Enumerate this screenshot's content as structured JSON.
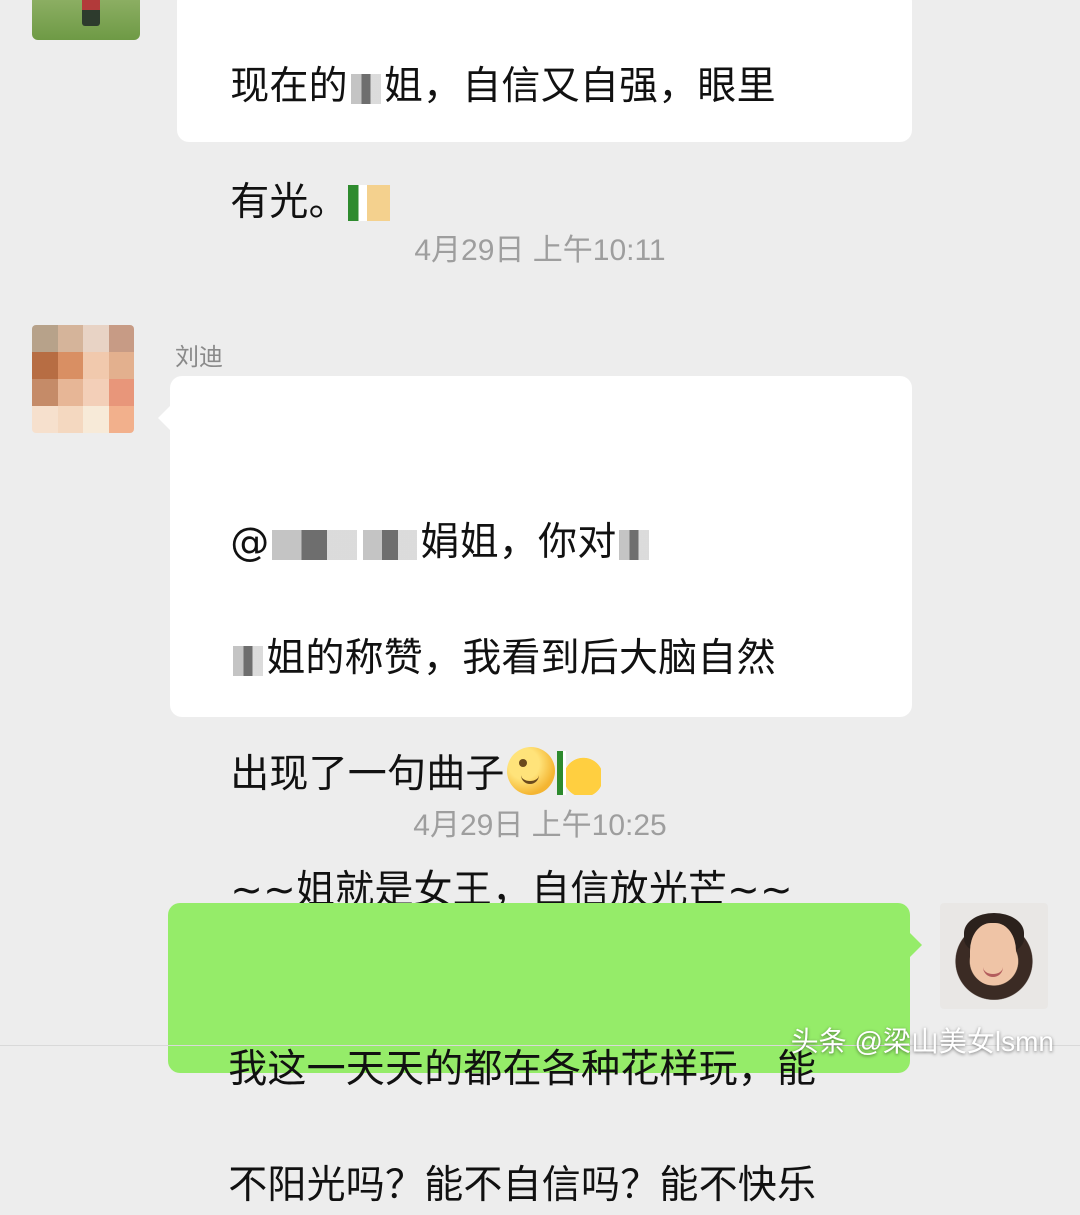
{
  "messages": {
    "top": {
      "text_prefix": "现在的",
      "text_suffix": "姐，自信又自强，眼里",
      "line2": "有光。"
    },
    "mid": {
      "sender": "刘迪",
      "line1_a": "@",
      "line1_b": "娟姐，你对",
      "line2": "姐的称赞，我看到后大脑自然",
      "line3": "出现了一句曲子",
      "line4": "~~姐就是女王，自信放光芒~~"
    },
    "bottom": {
      "line1": "我这一天天的都在各种花样玩，能",
      "line2": "不阳光吗？能不自信吗？能不快乐"
    }
  },
  "timestamps": {
    "first": "4月29日 上午10:11",
    "second": "4月29日 上午10:25"
  },
  "watermark": "头条 @梁山美女lsmn",
  "colors": {
    "background": "#ededed",
    "incoming": "#ffffff",
    "outgoing": "#95ec69",
    "timestamp": "#9e9e9e"
  },
  "icons": {
    "emoji": "smiling-face-icon",
    "thumbs": "thumbs-up-icon"
  }
}
